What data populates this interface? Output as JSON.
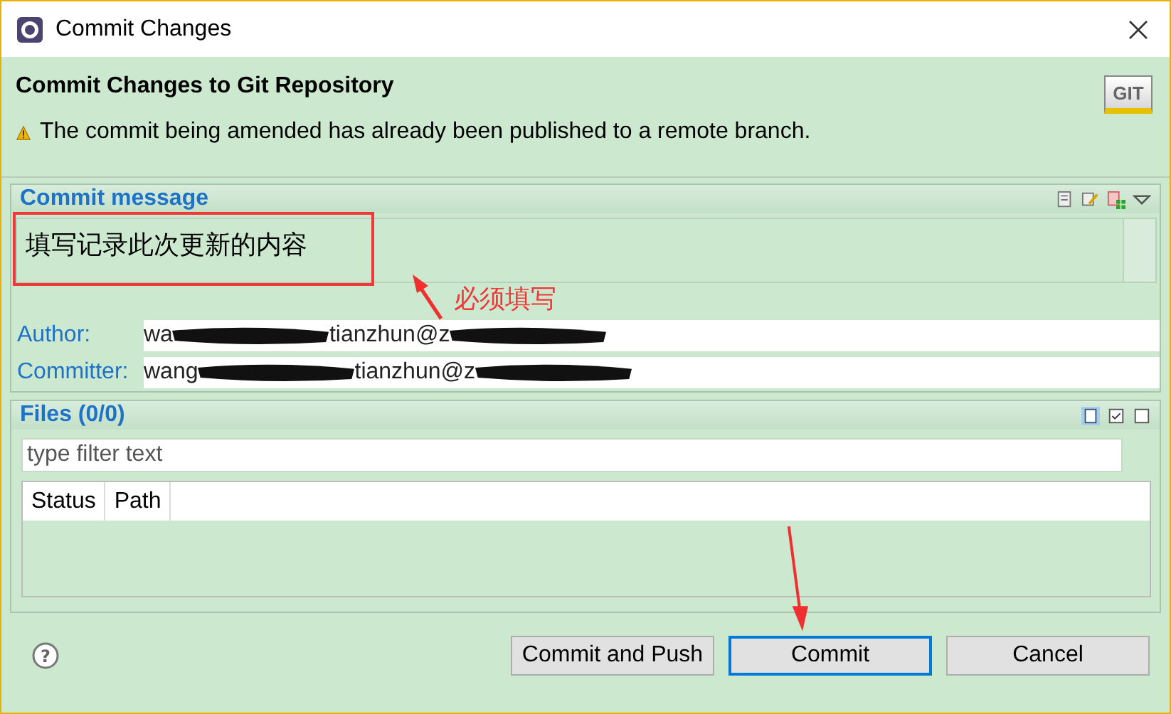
{
  "window": {
    "title": "Commit Changes"
  },
  "header": {
    "title": "Commit Changes to Git Repository",
    "warning": "The commit being amended has already been published to a remote branch.",
    "logo": "GIT"
  },
  "commit_message": {
    "title": "Commit message",
    "value": "填写记录此次更新的内容"
  },
  "people": [
    {
      "label": "Author:",
      "fragments": [
        "wa",
        "tianzhun@z"
      ]
    },
    {
      "label": "Committer:",
      "fragments": [
        "wang",
        "tianzhun@z"
      ]
    }
  ],
  "files": {
    "title": "Files (0/0)",
    "filter": {
      "placeholder": "type filter text"
    },
    "columns": [
      "Status",
      "Path"
    ]
  },
  "buttons": [
    {
      "label": "Commit and Push",
      "selected": false
    },
    {
      "label": "Commit",
      "selected": true
    },
    {
      "label": "Cancel",
      "selected": false
    }
  ],
  "help": {
    "glyph": "?"
  },
  "annotation": {
    "text": "必须填写"
  }
}
